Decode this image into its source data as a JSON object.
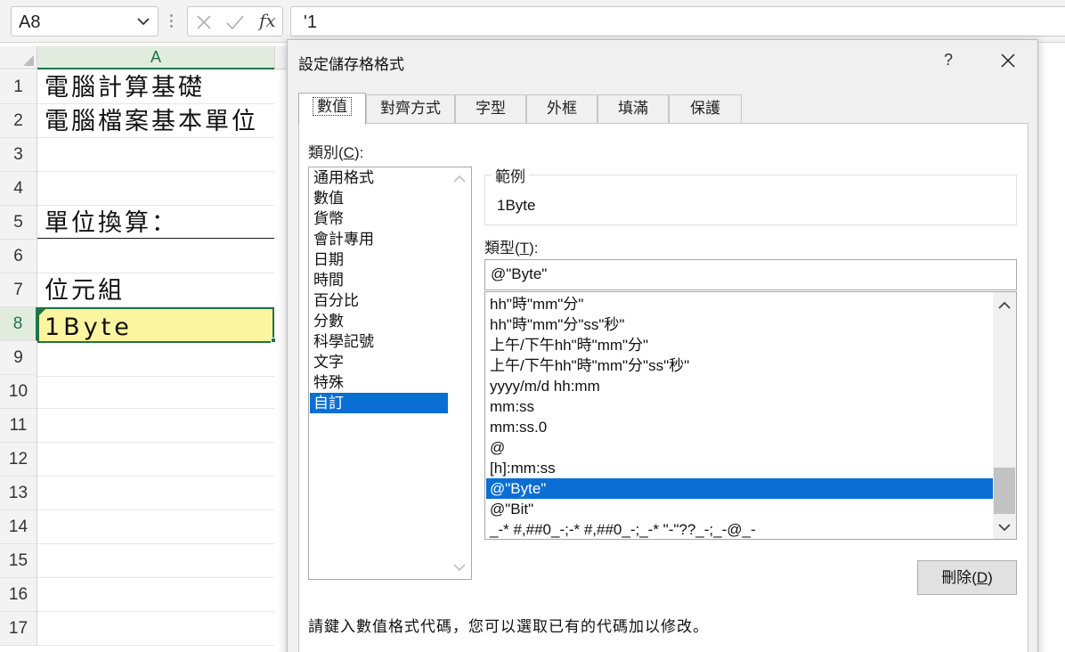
{
  "formula_bar": {
    "name_box": "A8",
    "cancel_icon": "x-icon",
    "enter_icon": "check-icon",
    "fx_label": "fx",
    "formula_value": "'1"
  },
  "sheet": {
    "column_header": "A",
    "rows": [
      {
        "num": "1",
        "text": "電腦計算基礎"
      },
      {
        "num": "2",
        "text": "電腦檔案基本單位"
      },
      {
        "num": "3",
        "text": ""
      },
      {
        "num": "4",
        "text": ""
      },
      {
        "num": "5",
        "text": "單位換算："
      },
      {
        "num": "6",
        "text": ""
      },
      {
        "num": "7",
        "text": "位元組"
      },
      {
        "num": "8",
        "text": "1Byte"
      },
      {
        "num": "9",
        "text": ""
      },
      {
        "num": "10",
        "text": ""
      },
      {
        "num": "11",
        "text": ""
      },
      {
        "num": "12",
        "text": ""
      },
      {
        "num": "13",
        "text": ""
      },
      {
        "num": "14",
        "text": ""
      },
      {
        "num": "15",
        "text": ""
      },
      {
        "num": "16",
        "text": ""
      },
      {
        "num": "17",
        "text": ""
      }
    ],
    "active_row": "8",
    "accent_color": "#217346",
    "active_fill": "#fbf5a0"
  },
  "dialog": {
    "title": "設定儲存格格式",
    "help": "?",
    "tabs": [
      "數值",
      "對齊方式",
      "字型",
      "外框",
      "填滿",
      "保護"
    ],
    "active_tab": "數值",
    "category_label": "類別",
    "category_key": "C",
    "categories": [
      "通用格式",
      "數值",
      "貨幣",
      "會計專用",
      "日期",
      "時間",
      "百分比",
      "分數",
      "科學記號",
      "文字",
      "特殊",
      "自訂"
    ],
    "selected_category": "自訂",
    "sample_label": "範例",
    "sample_value": "1Byte",
    "type_label": "類型",
    "type_key": "T",
    "type_value": "@\"Byte\"",
    "type_items": [
      "hh\"時\"mm\"分\"",
      "hh\"時\"mm\"分\"ss\"秒\"",
      "上午/下午hh\"時\"mm\"分\"",
      "上午/下午hh\"時\"mm\"分\"ss\"秒\"",
      "yyyy/m/d hh:mm",
      "mm:ss",
      "mm:ss.0",
      "@",
      "[h]:mm:ss",
      "@\"Byte\"",
      "@\"Bit\"",
      "_-* #,##0_-;-* #,##0_-;_-* \"-\"??_-;_-@_-"
    ],
    "selected_type": "@\"Byte\"",
    "delete_label": "刪除",
    "delete_key": "D",
    "hint": "請鍵入數值格式代碼，您可以選取已有的代碼加以修改。",
    "selection_color": "#0a6ed4"
  }
}
